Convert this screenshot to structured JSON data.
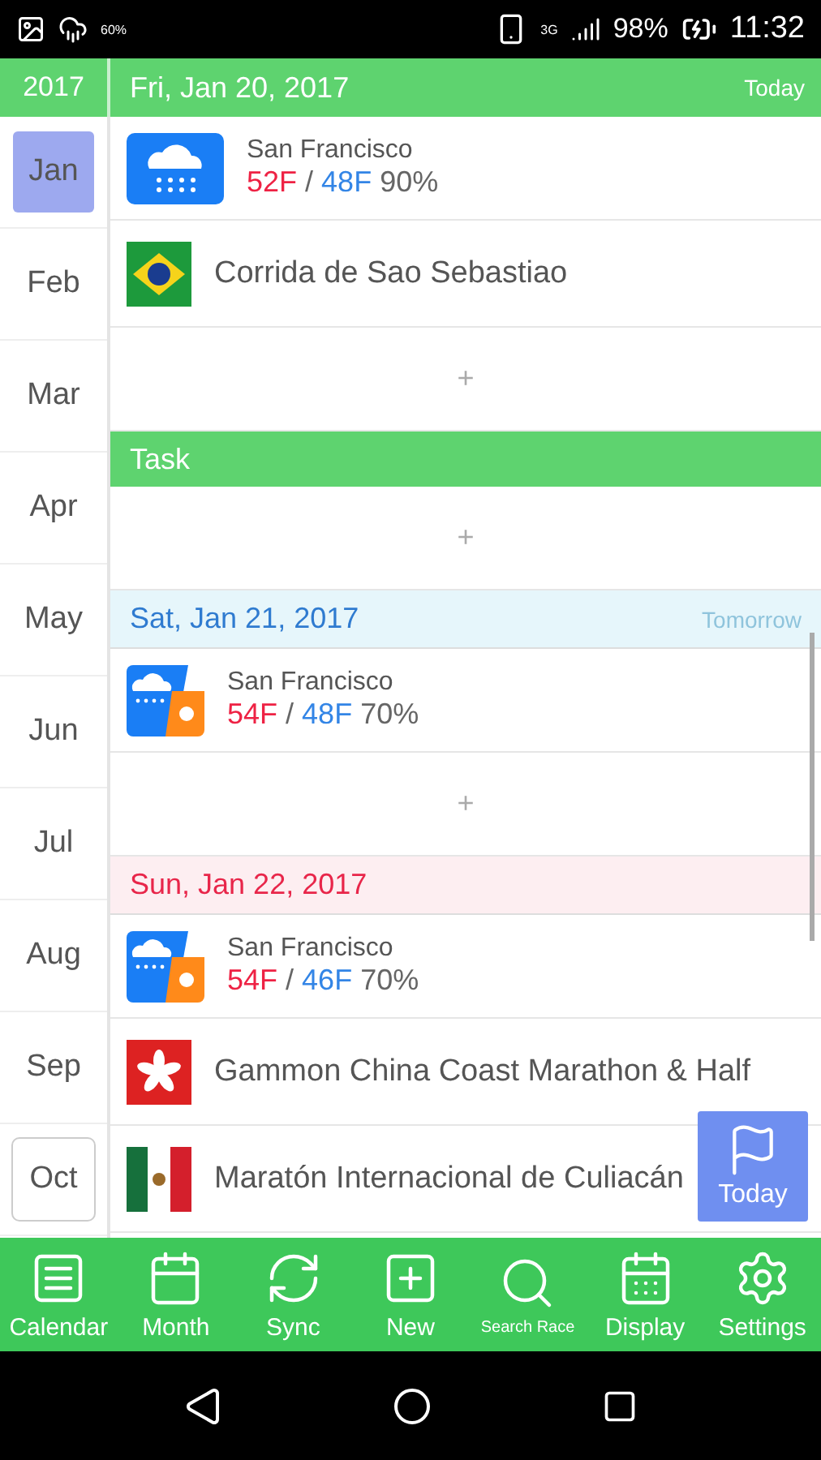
{
  "status_bar": {
    "weather_badge": "60%",
    "network": "3G",
    "battery": "98%",
    "time": "11:32"
  },
  "header": {
    "year": "2017",
    "date": "Fri, Jan 20, 2017",
    "tag": "Today"
  },
  "months": [
    {
      "label": "Jan",
      "selected": true
    },
    {
      "label": "Feb",
      "selected": false
    },
    {
      "label": "Mar",
      "selected": false
    },
    {
      "label": "Apr",
      "selected": false
    },
    {
      "label": "May",
      "selected": false
    },
    {
      "label": "Jun",
      "selected": false
    },
    {
      "label": "Jul",
      "selected": false
    },
    {
      "label": "Aug",
      "selected": false
    },
    {
      "label": "Sep",
      "selected": false
    },
    {
      "label": "Oct",
      "selected": false
    }
  ],
  "rows": [
    {
      "kind": "rain",
      "city": "San Francisco",
      "high": "52F",
      "separator": "/",
      "low": "48F",
      "chance": "90%"
    },
    {
      "kind": "race",
      "title": "Corrida de Sao Sebastiao"
    },
    {
      "kind": "add",
      "symbol": "+"
    },
    {
      "kind": "task",
      "title": "Task"
    },
    {
      "kind": "add",
      "symbol": "+"
    },
    {
      "kind": "saturday",
      "date": "Sat, Jan 21, 2017",
      "tag": "Tomorrow"
    },
    {
      "kind": "showers",
      "city": "San Francisco",
      "high": "54F",
      "separator": "/",
      "low": "48F",
      "chance": "70%"
    },
    {
      "kind": "add",
      "symbol": "+"
    },
    {
      "kind": "sunday",
      "date": "Sun, Jan 22, 2017"
    },
    {
      "kind": "showers",
      "city": "San Francisco",
      "high": "54F",
      "separator": "/",
      "low": "46F",
      "chance": "70%"
    },
    {
      "kind": "race",
      "title": "Gammon China Coast Marathon & Half"
    },
    {
      "kind": "race",
      "title": "Maratón Internacional de Culiacán"
    }
  ],
  "fab": {
    "label": "Today"
  },
  "nav": [
    {
      "label": "Calendar",
      "small": false
    },
    {
      "label": "Month",
      "small": false
    },
    {
      "label": "Sync",
      "small": false
    },
    {
      "label": "New",
      "small": false
    },
    {
      "label": "Search Race",
      "small": true
    },
    {
      "label": "Display",
      "small": false
    },
    {
      "label": "Settings",
      "small": false
    }
  ]
}
